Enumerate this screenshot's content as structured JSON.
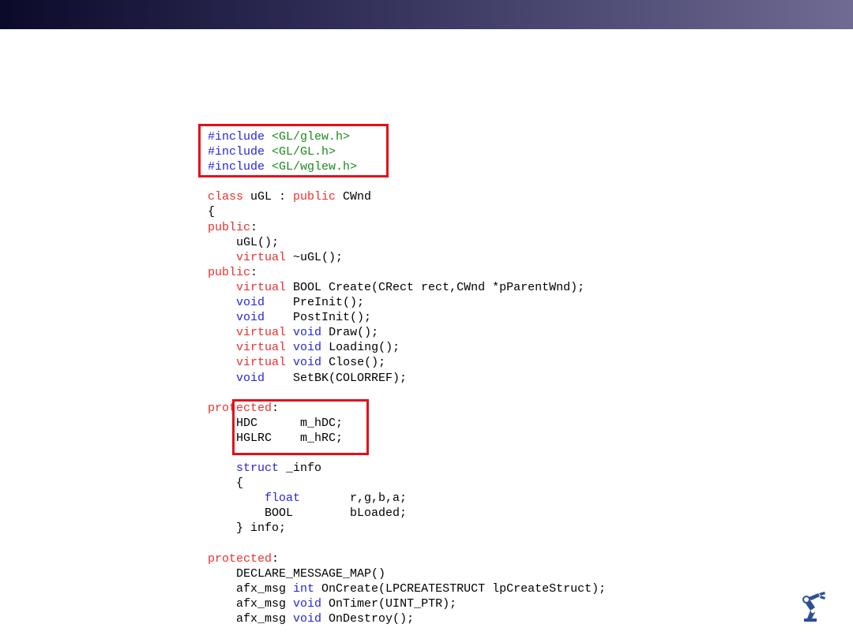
{
  "code": {
    "lines": [
      {
        "segments": [
          {
            "t": "#include ",
            "c": "blue"
          },
          {
            "t": "<GL/glew.h>",
            "c": "green"
          }
        ]
      },
      {
        "segments": [
          {
            "t": "#include ",
            "c": "blue"
          },
          {
            "t": "<GL/GL.h>",
            "c": "green"
          }
        ]
      },
      {
        "segments": [
          {
            "t": "#include ",
            "c": "blue"
          },
          {
            "t": "<GL/wglew.h>",
            "c": "green"
          }
        ]
      },
      {
        "segments": []
      },
      {
        "segments": [
          {
            "t": "class",
            "c": "red"
          },
          {
            "t": " uGL : "
          },
          {
            "t": "public",
            "c": "red"
          },
          {
            "t": " CWnd"
          }
        ]
      },
      {
        "segments": [
          {
            "t": "{"
          }
        ]
      },
      {
        "segments": [
          {
            "t": "public",
            "c": "red"
          },
          {
            "t": ":"
          }
        ]
      },
      {
        "segments": [
          {
            "t": "    uGL();"
          }
        ]
      },
      {
        "segments": [
          {
            "t": "    "
          },
          {
            "t": "virtual",
            "c": "red"
          },
          {
            "t": " ~uGL();"
          }
        ]
      },
      {
        "segments": [
          {
            "t": "public",
            "c": "red"
          },
          {
            "t": ":"
          }
        ]
      },
      {
        "segments": [
          {
            "t": "    "
          },
          {
            "t": "virtual",
            "c": "red"
          },
          {
            "t": " BOOL Create(CRect rect,CWnd *pParentWnd);"
          }
        ]
      },
      {
        "segments": [
          {
            "t": "    "
          },
          {
            "t": "void",
            "c": "blue"
          },
          {
            "t": "    PreInit();"
          }
        ]
      },
      {
        "segments": [
          {
            "t": "    "
          },
          {
            "t": "void",
            "c": "blue"
          },
          {
            "t": "    PostInit();"
          }
        ]
      },
      {
        "segments": [
          {
            "t": "    "
          },
          {
            "t": "virtual",
            "c": "red"
          },
          {
            "t": " "
          },
          {
            "t": "void",
            "c": "blue"
          },
          {
            "t": " Draw();"
          }
        ]
      },
      {
        "segments": [
          {
            "t": "    "
          },
          {
            "t": "virtual",
            "c": "red"
          },
          {
            "t": " "
          },
          {
            "t": "void",
            "c": "blue"
          },
          {
            "t": " Loading();"
          }
        ]
      },
      {
        "segments": [
          {
            "t": "    "
          },
          {
            "t": "virtual",
            "c": "red"
          },
          {
            "t": " "
          },
          {
            "t": "void",
            "c": "blue"
          },
          {
            "t": " Close();"
          }
        ]
      },
      {
        "segments": [
          {
            "t": "    "
          },
          {
            "t": "void",
            "c": "blue"
          },
          {
            "t": "    SetBK(COLORREF);"
          }
        ]
      },
      {
        "segments": []
      },
      {
        "segments": [
          {
            "t": "protected",
            "c": "red"
          },
          {
            "t": ":"
          }
        ]
      },
      {
        "segments": [
          {
            "t": "    HDC      m_hDC;"
          }
        ]
      },
      {
        "segments": [
          {
            "t": "    HGLRC    m_hRC;"
          }
        ]
      },
      {
        "segments": []
      },
      {
        "segments": [
          {
            "t": "    "
          },
          {
            "t": "struct",
            "c": "blue"
          },
          {
            "t": " _info"
          }
        ]
      },
      {
        "segments": [
          {
            "t": "    {"
          }
        ]
      },
      {
        "segments": [
          {
            "t": "        "
          },
          {
            "t": "float",
            "c": "blue"
          },
          {
            "t": "       r,g,b,a;"
          }
        ]
      },
      {
        "segments": [
          {
            "t": "        BOOL        bLoaded;"
          }
        ]
      },
      {
        "segments": [
          {
            "t": "    } info;"
          }
        ]
      },
      {
        "segments": []
      },
      {
        "segments": [
          {
            "t": "protected",
            "c": "red"
          },
          {
            "t": ":"
          }
        ]
      },
      {
        "segments": [
          {
            "t": "    DECLARE_MESSAGE_MAP()"
          }
        ]
      },
      {
        "segments": [
          {
            "t": "    afx_msg "
          },
          {
            "t": "int",
            "c": "blue"
          },
          {
            "t": " OnCreate(LPCREATESTRUCT lpCreateStruct);"
          }
        ]
      },
      {
        "segments": [
          {
            "t": "    afx_msg "
          },
          {
            "t": "void",
            "c": "blue"
          },
          {
            "t": " OnTimer(UINT_PTR);"
          }
        ]
      },
      {
        "segments": [
          {
            "t": "    afx_msg "
          },
          {
            "t": "void",
            "c": "blue"
          },
          {
            "t": " OnDestroy();"
          }
        ]
      }
    ]
  },
  "colors": {
    "red": "#e8312f",
    "blue": "#2626d8",
    "green": "#1c8a1c",
    "highlight_box": "#e2101a",
    "logo": "#2e4f96"
  },
  "logo": {
    "icon": "robot-arm-icon"
  }
}
